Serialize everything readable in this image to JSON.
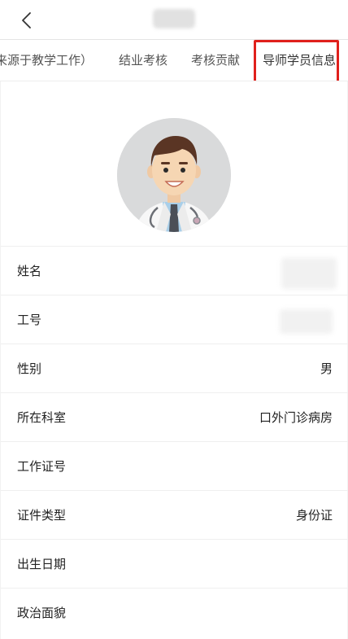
{
  "nav": {
    "back_icon": "chevron-left-icon",
    "title": ""
  },
  "tabs": [
    {
      "label": "来源于教学工作）"
    },
    {
      "label": "结业考核"
    },
    {
      "label": "考核贡献"
    },
    {
      "label": "导师学员信息",
      "selected": true
    }
  ],
  "highlight_color": "#e0201c",
  "profile": {
    "avatar_icon": "doctor-avatar-icon"
  },
  "info_rows": [
    {
      "label": "姓名",
      "value": ""
    },
    {
      "label": "工号",
      "value": ""
    },
    {
      "label": "性别",
      "value": "男"
    },
    {
      "label": "所在科室",
      "value": "口外门诊病房"
    },
    {
      "label": "工作证号",
      "value": ""
    },
    {
      "label": "证件类型",
      "value": "身份证"
    },
    {
      "label": "出生日期",
      "value": ""
    },
    {
      "label": "政治面貌",
      "value": ""
    }
  ]
}
